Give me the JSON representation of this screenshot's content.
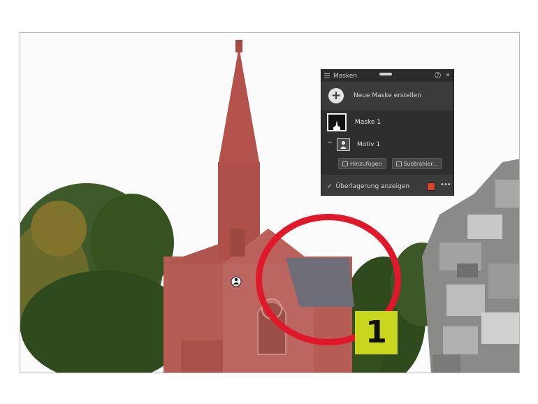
{
  "panel": {
    "title": "Masken",
    "new_mask_label": "Neue Maske erstellen",
    "mask_name": "Maske 1",
    "sub_mask_name": "Motiv 1",
    "add_button": "Hinzufügen",
    "subtract_button": "Subtrahier...",
    "overlay_label": "Überlagerung anzeigen",
    "overlay_checked": true,
    "overlay_color": "#d7452a"
  },
  "icons": {
    "menu": "menu-icon",
    "help": "help-icon",
    "expand": "double-chevron-right-icon",
    "add": "plus-icon",
    "link": "link-icon",
    "person": "person-icon",
    "more": "more-icon"
  },
  "annotation": {
    "step_number": "1",
    "circle_color": "#e0192a",
    "badge_color": "#c9d61e"
  },
  "mask_overlay_color": "#c0392b"
}
